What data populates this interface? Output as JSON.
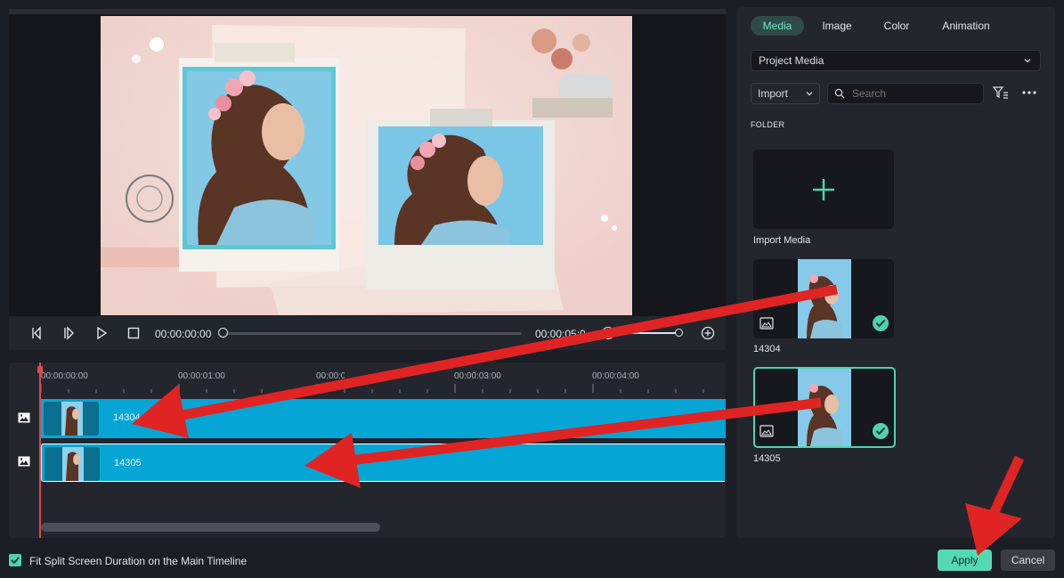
{
  "preview": {
    "timecode_current": "00:00:00:00",
    "timecode_end": "00:00:05:00"
  },
  "timeline": {
    "ruler": [
      "00:00:00:00",
      "00:00:01:00",
      "00:00:02:00",
      "00:00:03:00",
      "00:00:04:00"
    ],
    "tracks": [
      {
        "label": "14304"
      },
      {
        "label": "14305"
      }
    ]
  },
  "media_panel": {
    "tabs": [
      {
        "label": "Media",
        "active": true
      },
      {
        "label": "Image",
        "active": false
      },
      {
        "label": "Color",
        "active": false
      },
      {
        "label": "Animation",
        "active": false
      }
    ],
    "source_select": "Project Media",
    "import_label": "Import",
    "search_placeholder": "Search",
    "folder_heading": "FOLDER",
    "import_media_label": "Import Media",
    "items": [
      {
        "label": "14304",
        "selected": false
      },
      {
        "label": "14305",
        "selected": true
      }
    ]
  },
  "footer": {
    "fit_label": "Fit Split Screen Duration on the Main Timeline",
    "fit_checked": true,
    "apply_label": "Apply",
    "cancel_label": "Cancel"
  },
  "colors": {
    "accent": "#4ed3b0",
    "clip": "#05a6d6",
    "annotation_arrow": "#e02424",
    "playhead": "#e24848"
  },
  "icons": [
    "prev-frame-icon",
    "next-frame-icon",
    "play-icon",
    "stop-icon",
    "zoom-in-icon",
    "image-track-icon",
    "filter-icon",
    "more-icon",
    "chevron-down-icon",
    "search-icon",
    "plus-icon",
    "image-icon",
    "check-icon"
  ]
}
